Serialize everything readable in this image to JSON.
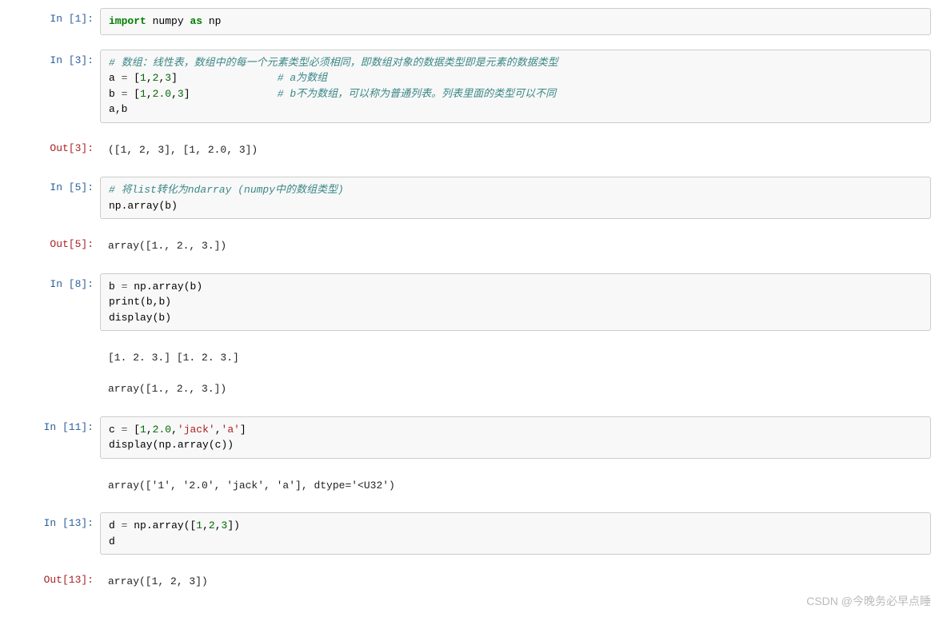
{
  "cells": [
    {
      "type": "in",
      "n": 1,
      "prompt": "In  [1]:",
      "code_html": "<span class='kw'>import</span> <span class='name'>numpy</span> <span class='kw'>as</span> <span class='name'>np</span>"
    },
    {
      "type": "in",
      "n": 3,
      "prompt": "In  [3]:",
      "code_html": "<span class='cm'># 数组：线性表，数组中的每一个元素类型必须相同，即数组对象的数据类型即是元素的数据类型</span>\n<span class='name'>a</span> <span class='op'>=</span> [<span class='num'>1</span>,<span class='num'>2</span>,<span class='num'>3</span>]                <span class='cm'># a为数组</span>\n<span class='name'>b</span> <span class='op'>=</span> [<span class='num'>1</span>,<span class='num'>2.0</span>,<span class='num'>3</span>]              <span class='cm'># b不为数组，可以称为普通列表。列表里面的类型可以不同</span>\n<span class='name'>a</span>,<span class='name'>b</span>"
    },
    {
      "type": "out",
      "n": 3,
      "prompt": "Out[3]:",
      "text": "([1, 2, 3], [1, 2.0, 3])"
    },
    {
      "type": "in",
      "n": 5,
      "prompt": "In  [5]:",
      "code_html": "<span class='cm'># 将list转化为ndarray (numpy中的数组类型)</span>\n<span class='name'>np</span>.<span class='fn'>array</span>(<span class='name'>b</span>)"
    },
    {
      "type": "out",
      "n": 5,
      "prompt": "Out[5]:",
      "text": "array([1., 2., 3.])"
    },
    {
      "type": "in",
      "n": 8,
      "prompt": "In  [8]:",
      "code_html": "<span class='name'>b</span> <span class='op'>=</span> <span class='name'>np</span>.<span class='fn'>array</span>(<span class='name'>b</span>)\n<span class='fn'>print</span>(<span class='name'>b</span>,<span class='name'>b</span>)\n<span class='fn'>display</span>(<span class='name'>b</span>)"
    },
    {
      "type": "stream",
      "text": "[1. 2. 3.] [1. 2. 3.]\n\narray([1., 2., 3.])"
    },
    {
      "type": "in",
      "n": 11,
      "prompt": "In  [11]:",
      "code_html": "<span class='name'>c</span> <span class='op'>=</span> [<span class='num'>1</span>,<span class='num'>2.0</span>,<span class='str'>'jack'</span>,<span class='str'>'a'</span>]\n<span class='fn'>display</span>(<span class='name'>np</span>.<span class='fn'>array</span>(<span class='name'>c</span>))"
    },
    {
      "type": "stream",
      "text": "array(['1', '2.0', 'jack', 'a'], dtype='<U32')"
    },
    {
      "type": "in",
      "n": 13,
      "prompt": "In  [13]:",
      "code_html": "<span class='name'>d</span> <span class='op'>=</span> <span class='name'>np</span>.<span class='fn'>array</span>([<span class='num'>1</span>,<span class='num'>2</span>,<span class='num'>3</span>])\n<span class='name'>d</span>"
    },
    {
      "type": "out",
      "n": 13,
      "prompt": "Out[13]:",
      "text": "array([1, 2, 3])"
    }
  ],
  "watermark": "CSDN @今晚务必早点睡"
}
